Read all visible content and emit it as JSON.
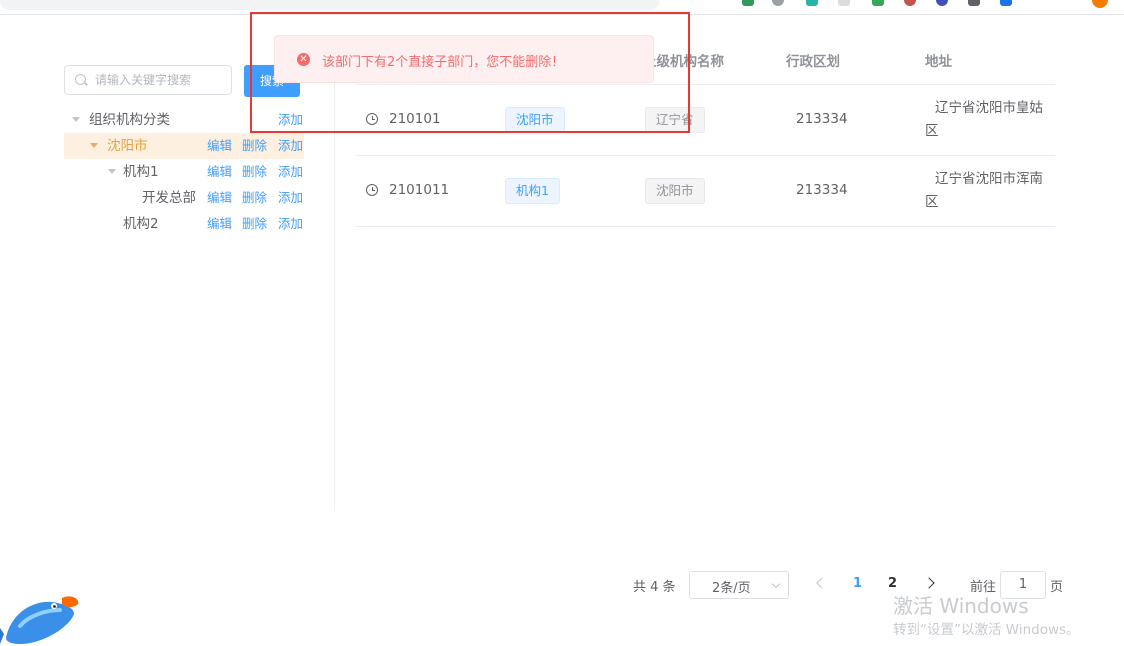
{
  "search": {
    "placeholder": "请输入关键字搜索",
    "button_label": "搜索"
  },
  "tree": {
    "root": {
      "label": "组织机构分类",
      "add": "添加"
    },
    "nodes": [
      {
        "label": "沈阳市",
        "edit": "编辑",
        "delete": "删除",
        "add": "添加"
      },
      {
        "label": "机构1",
        "edit": "编辑",
        "delete": "删除",
        "add": "添加"
      },
      {
        "label": "开发总部",
        "edit": "编辑",
        "delete": "删除",
        "add": "添加"
      },
      {
        "label": "机构2",
        "edit": "编辑",
        "delete": "删除",
        "add": "添加"
      }
    ]
  },
  "table": {
    "headers": {
      "parent_name": "上级机构名称",
      "region": "行政区划",
      "address": "地址"
    },
    "rows": [
      {
        "code": "210101",
        "name": "沈阳市",
        "parent": "辽宁省",
        "region": "213334",
        "address": "辽宁省沈阳市皇姑区"
      },
      {
        "code": "2101011",
        "name": "机构1",
        "parent": "沈阳市",
        "region": "213334",
        "address": "辽宁省沈阳市浑南区"
      }
    ]
  },
  "toast": {
    "message": "该部门下有2个直接子部门，您不能删除！"
  },
  "pagination": {
    "total": "共 4 条",
    "page_size": "2条/页",
    "pages": [
      "1",
      "2"
    ],
    "current": "1",
    "goto_label": "前往",
    "goto_value": "1",
    "goto_unit": "页"
  },
  "watermark": {
    "title": "激活 Windows",
    "subtitle": "转到“设置”以激活 Windows。"
  },
  "colors": {
    "primary": "#409eff",
    "error": "#f56c6c",
    "active_node": "#e6a23c",
    "highlight_box": "#e53935"
  }
}
